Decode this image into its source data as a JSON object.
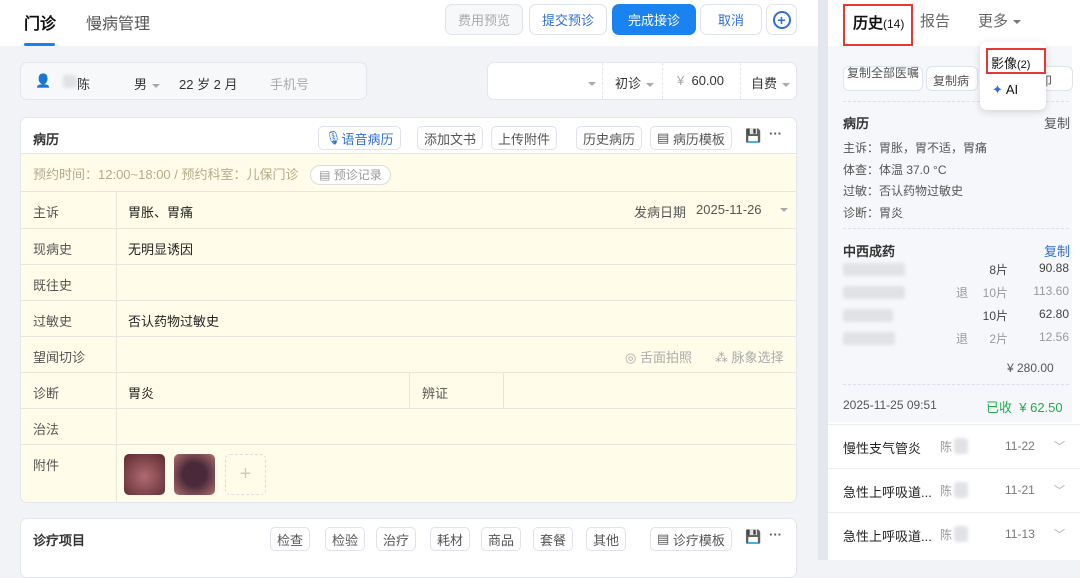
{
  "header": {
    "tabs": [
      "门诊",
      "慢病管理"
    ],
    "buttons": {
      "fee_preview": "费用预览",
      "submit_prediag": "提交预诊",
      "finish": "完成接诊",
      "cancel": "取消",
      "add": "+"
    }
  },
  "patient": {
    "name": "陈",
    "gender": "男",
    "age": "22 岁  2 月",
    "phone_placeholder": "手机号"
  },
  "visit": {
    "type": "初诊",
    "currency": "¥",
    "fee": "60.00",
    "pay": "自费"
  },
  "record": {
    "title": "病历",
    "tools": [
      "语音病历",
      "添加文书",
      "上传附件",
      "历史病历",
      "病历模板"
    ],
    "appointment": "预约时间：12:00~18:00 / 预约科室：儿保门诊",
    "prediag_record": "预诊记录",
    "rows": {
      "chief": {
        "label": "主诉",
        "value": "胃胀、胃痛",
        "onset_label": "发病日期",
        "onset": "2025-11-26"
      },
      "present": {
        "label": "现病史",
        "value": "无明显诱因"
      },
      "past": {
        "label": "既往史",
        "value": ""
      },
      "allergy": {
        "label": "过敏史",
        "value": "否认药物过敏史"
      },
      "tcm": {
        "label": "望闻切诊",
        "tongue": "舌面拍照",
        "pulse": "脉象选择"
      },
      "diagnosis": {
        "label": "诊断",
        "value": "胃炎",
        "syndrome_label": "辨证"
      },
      "therapy": {
        "label": "治法"
      },
      "attach": {
        "label": "附件"
      }
    }
  },
  "items": {
    "title": "诊疗项目",
    "tools": [
      "检查",
      "检验",
      "治疗",
      "耗材",
      "商品",
      "套餐",
      "其他",
      "诊疗模板"
    ]
  },
  "right": {
    "tabs": {
      "history": "历史",
      "history_count": "(14)",
      "report": "报告",
      "more": "更多"
    },
    "dropdown": {
      "imaging": "影像",
      "imaging_count": "(2)",
      "ai": "AI"
    },
    "copy_buttons": [
      "复制全部医嘱",
      "复制病",
      "印"
    ],
    "record": {
      "title": "病历",
      "copy": "复制",
      "lines": [
        "主诉：胃胀，胃不适，胃痛",
        "体查：体温 37.0 °C",
        "过敏：否认药物过敏史",
        "诊断：胃炎"
      ]
    },
    "meds": {
      "title": "中西成药",
      "copy": "复制",
      "rows": [
        {
          "ret": "",
          "qty": "8片",
          "amt": "90.88"
        },
        {
          "ret": "退",
          "qty": "10片",
          "amt": "113.60"
        },
        {
          "ret": "",
          "qty": "10片",
          "amt": "62.80"
        },
        {
          "ret": "退",
          "qty": "2片",
          "amt": "12.56"
        }
      ],
      "total": "¥ 280.00"
    },
    "visit_time": "2025-11-25 09:51",
    "paid_label": "已收",
    "paid": "¥ 62.50",
    "history": [
      {
        "diag": "慢性支气管炎",
        "doctor": "陈",
        "date": "11-22"
      },
      {
        "diag": "急性上呼吸道...",
        "doctor": "陈",
        "date": "11-21"
      },
      {
        "diag": "急性上呼吸道...",
        "doctor": "陈",
        "date": "11-13"
      }
    ]
  },
  "colors": {
    "primary": "#1a83f0",
    "paid": "#1fad4f",
    "highlight": "#e53935"
  }
}
